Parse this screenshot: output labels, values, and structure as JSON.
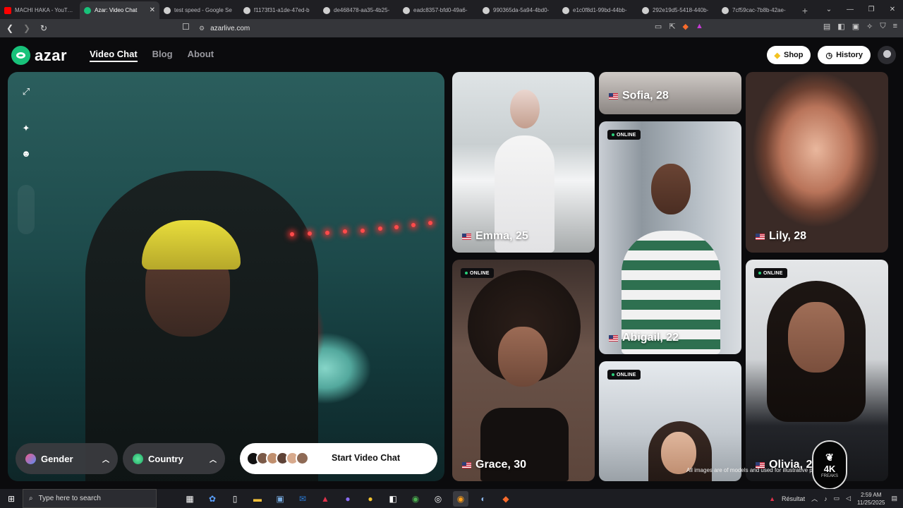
{
  "browser": {
    "tabs": [
      {
        "title": "MACHI HAKA - YouTube",
        "color": "#ff0000",
        "active": false
      },
      {
        "title": "Azar: Video Chat",
        "color": "#18c27a",
        "active": true
      },
      {
        "title": "test speed - Google Se",
        "color": "#cfcfcf",
        "active": false
      },
      {
        "title": "f1173f31-a1de-47ed-b",
        "color": "#cfcfcf",
        "active": false
      },
      {
        "title": "de468478-aa35-4b25-",
        "color": "#cfcfcf",
        "active": false
      },
      {
        "title": "eadc8357-bfd0-49a6-",
        "color": "#cfcfcf",
        "active": false
      },
      {
        "title": "990365da-5a94-4bd0-",
        "color": "#cfcfcf",
        "active": false
      },
      {
        "title": "e1c0f8d1-99bd-44bb-",
        "color": "#cfcfcf",
        "active": false
      },
      {
        "title": "292e19d5-5418-440b-",
        "color": "#cfcfcf",
        "active": false
      },
      {
        "title": "7cf59cac-7b8b-42ae-",
        "color": "#cfcfcf",
        "active": false
      }
    ],
    "new_tab": "+",
    "url": "azarlive.com"
  },
  "site": {
    "logo": "azar",
    "nav": [
      {
        "label": "Video Chat",
        "active": true
      },
      {
        "label": "Blog",
        "active": false
      },
      {
        "label": "About",
        "active": false
      }
    ],
    "shop_label": "Shop",
    "history_label": "History"
  },
  "video": {
    "filters": {
      "gender_label": "Gender",
      "country_label": "Country"
    },
    "start_label": "Start Video Chat"
  },
  "profiles": [
    {
      "name": "Emma, 25",
      "online": false
    },
    {
      "name": "Sofia, 28",
      "online": false
    },
    {
      "name": "Lily, 28",
      "online": false
    },
    {
      "name": "Abigail, 22",
      "online": true
    },
    {
      "name": "Grace, 30",
      "online": true
    },
    {
      "name": "Olivia, 2",
      "online": true
    },
    {
      "name": "",
      "online": true
    }
  ],
  "online_label": "ONLINE",
  "footnote": "All images are of models and used for illustrative purposes only.",
  "watermark": {
    "big": "4K",
    "small": "FREAKS"
  },
  "taskbar": {
    "search_placeholder": "Type here to search",
    "tray_label": "Résultat",
    "time": "2:59 AM",
    "date": "11/25/2025"
  }
}
